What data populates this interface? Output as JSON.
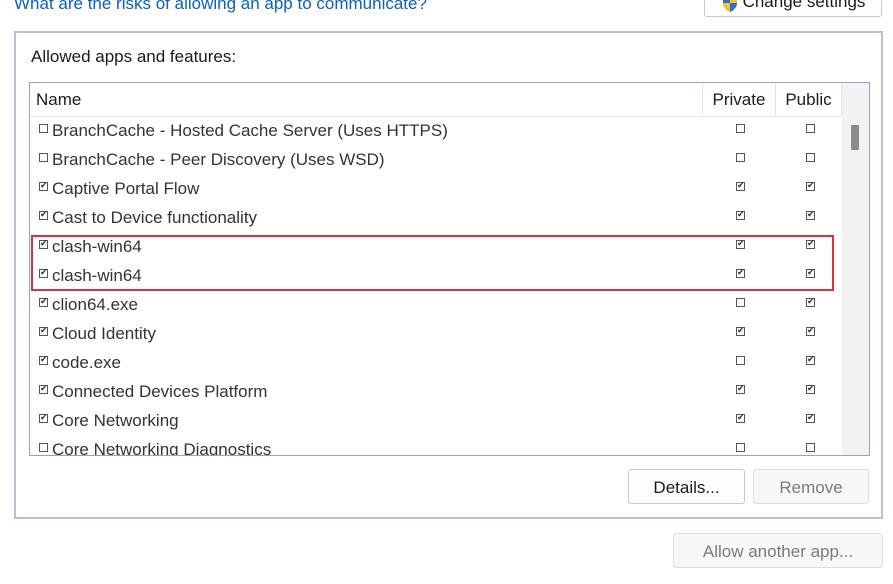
{
  "link": {
    "risks_text": "What are the risks of allowing an app to communicate?"
  },
  "buttons": {
    "change_settings": "Change settings",
    "details": "Details...",
    "remove": "Remove",
    "allow_another": "Allow another app..."
  },
  "group": {
    "label": "Allowed apps and features:"
  },
  "columns": {
    "name": "Name",
    "private": "Private",
    "public": "Public"
  },
  "rows": [
    {
      "name": "BranchCache - Hosted Cache Server (Uses HTTPS)",
      "enabled": false,
      "private": false,
      "public": false
    },
    {
      "name": "BranchCache - Peer Discovery (Uses WSD)",
      "enabled": false,
      "private": false,
      "public": false
    },
    {
      "name": "Captive Portal Flow",
      "enabled": true,
      "private": true,
      "public": true
    },
    {
      "name": "Cast to Device functionality",
      "enabled": true,
      "private": true,
      "public": true
    },
    {
      "name": "clash-win64",
      "enabled": true,
      "private": true,
      "public": true
    },
    {
      "name": "clash-win64",
      "enabled": true,
      "private": true,
      "public": true
    },
    {
      "name": "clion64.exe",
      "enabled": true,
      "private": false,
      "public": true
    },
    {
      "name": "Cloud Identity",
      "enabled": true,
      "private": true,
      "public": true
    },
    {
      "name": "code.exe",
      "enabled": true,
      "private": false,
      "public": true
    },
    {
      "name": "Connected Devices Platform",
      "enabled": true,
      "private": true,
      "public": true
    },
    {
      "name": "Core Networking",
      "enabled": true,
      "private": true,
      "public": true
    },
    {
      "name": "Core Networking Diagnostics",
      "enabled": false,
      "private": false,
      "public": false
    }
  ],
  "colors": {
    "link": "#0a5fc7",
    "highlight": "#d8323c",
    "group_border": "#b9bfd9"
  },
  "icons": {
    "change_settings": "uac-shield-icon",
    "check": "checkmark-icon"
  }
}
